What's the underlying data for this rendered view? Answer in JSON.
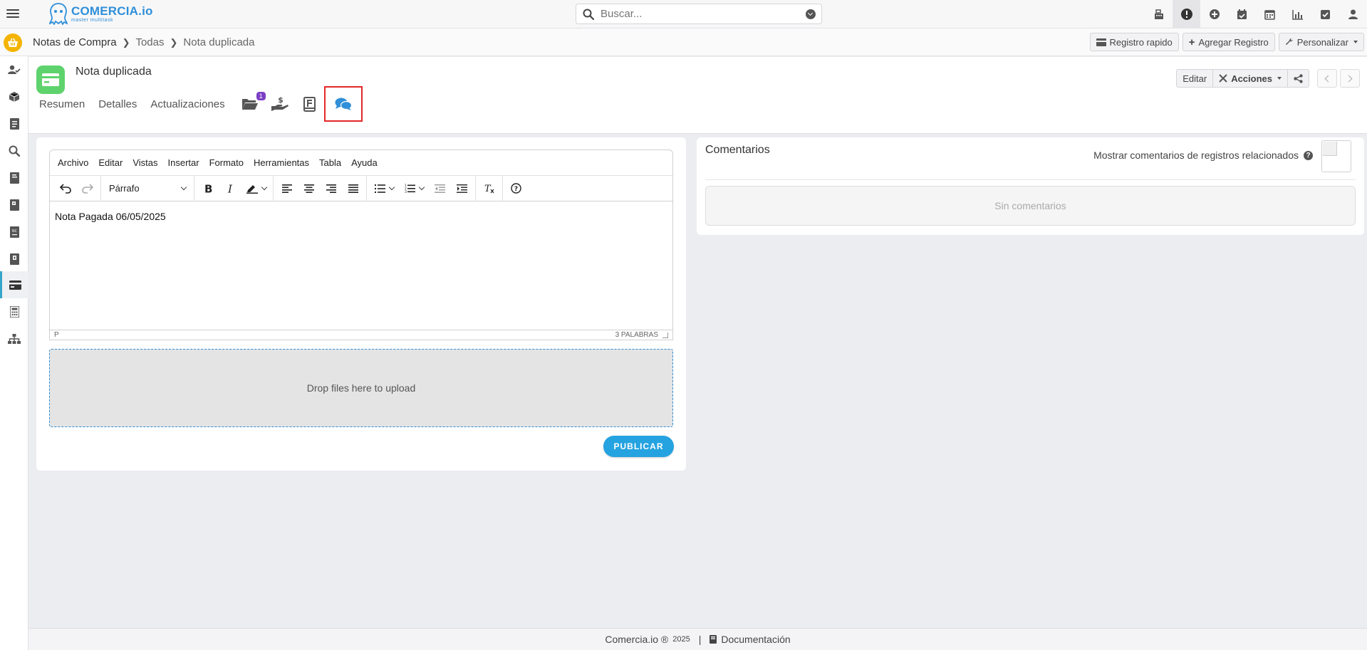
{
  "app": {
    "brand": "COMERCIA.io",
    "brand_sub": "master multitask"
  },
  "search": {
    "placeholder": "Buscar..."
  },
  "top_icons": [
    "cash-register-icon",
    "alert-icon",
    "add-circle-icon",
    "calendar-check-icon",
    "calendar-icon",
    "chart-icon",
    "checkbox-icon",
    "user-icon"
  ],
  "breadcrumb": {
    "module": "Notas de Compra",
    "list": "Todas",
    "current": "Nota duplicada"
  },
  "header_actions": {
    "quick_record": "Registro rapido",
    "add_record": "Agregar Registro",
    "customize": "Personalizar"
  },
  "sidebar_items": [
    "contacts-icon",
    "box-icon",
    "document-icon",
    "search-doc-icon",
    "invoice-icon",
    "bill-icon",
    "credit-note-icon",
    "ledger-icon",
    "purchase-note-icon",
    "calculator-icon",
    "hierarchy-icon"
  ],
  "record": {
    "title": "Nota duplicada",
    "edit": "Editar",
    "actions": "Acciones"
  },
  "tabs": {
    "summary": "Resumen",
    "details": "Detalles",
    "updates": "Actualizaciones",
    "files_badge": "1"
  },
  "editor": {
    "menu": [
      "Archivo",
      "Editar",
      "Vistas",
      "Insertar",
      "Formato",
      "Herramientas",
      "Tabla",
      "Ayuda"
    ],
    "block_format": "Párrafo",
    "content": "Nota Pagada 06/05/2025",
    "path": "P",
    "word_count": "3 PALABRAS"
  },
  "dropzone": {
    "label": "Drop files here to upload"
  },
  "publish_label": "PUBLICAR",
  "comments": {
    "title": "Comentarios",
    "related_label": "Mostrar comentarios de registros relacionados",
    "empty": "Sin comentarios"
  },
  "footer": {
    "brand": "Comercia.io ®",
    "year": "2025",
    "docs": "Documentación"
  },
  "colors": {
    "accent": "#25a3e0",
    "brand": "#2f8fd8",
    "record_icon": "#5ed36d",
    "badge": "#7b3fc4",
    "highlight": "#e22828",
    "basket": "#f4b400"
  }
}
